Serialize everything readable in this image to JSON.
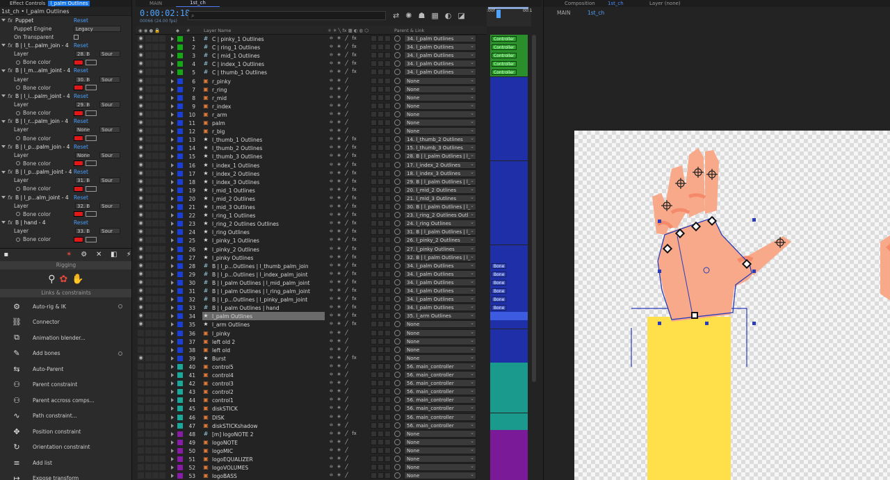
{
  "effect_controls": {
    "tab_label": "Effect Controls",
    "tab_layer": "l_palm Outlines",
    "breadcrumb": "1st_ch • l_palm Outlines",
    "puppet": {
      "label": "Puppet",
      "reset": "Reset",
      "engine_label": "Puppet Engine",
      "engine_value": "Legacy",
      "transparent_label": "On Transparent"
    },
    "bones": [
      {
        "name": "B | l_t...palm_join - 4",
        "layer_value": "28. B",
        "sound": "Sour"
      },
      {
        "name": "B | l_m...alm_joint - 4",
        "layer_value": "30. B",
        "sound": "Sour"
      },
      {
        "name": "B | l_i...palm_joint - 4",
        "layer_value": "29. B",
        "sound": "Sour"
      },
      {
        "name": "B | l_r...palm_join - 4",
        "layer_value": "None",
        "sound": "Sour"
      },
      {
        "name": "B | l_p...palm_join - 4",
        "layer_value": "None",
        "sound": "Sour"
      },
      {
        "name": "B | l_p...palm_joint - 4",
        "layer_value": "31. B",
        "sound": "Sour"
      },
      {
        "name": "B | l_p...alm_joint - 4",
        "layer_value": "32. B",
        "sound": "Sour"
      },
      {
        "name": "B | hand - 4",
        "layer_value": "33. B",
        "sound": "Sour"
      }
    ],
    "reset_label": "Reset",
    "layer_label": "Layer",
    "bone_color_label": "Bone color",
    "bone_color": "#e01818"
  },
  "rigging": {
    "title": "Rigging",
    "links_title": "Links & constraints",
    "tools": [
      {
        "icon": "⚙",
        "label": "Auto-rig & IK",
        "dot": true
      },
      {
        "icon": "⛓",
        "label": "Connector",
        "dot": false
      },
      {
        "icon": "⧉",
        "label": "Animation blender...",
        "dot": false
      },
      {
        "icon": "✎",
        "label": "Add bones",
        "dot": true
      },
      {
        "icon": "⇆",
        "label": "Auto-Parent",
        "dot": false
      },
      {
        "icon": "⚇",
        "label": "Parent constraint",
        "dot": false
      },
      {
        "icon": "⚇",
        "label": "Parent accross comps...",
        "dot": false
      },
      {
        "icon": "∿",
        "label": "Path constraint...",
        "dot": false
      },
      {
        "icon": "✥",
        "label": "Position constraint",
        "dot": false
      },
      {
        "icon": "↻",
        "label": "Orientation constraint",
        "dot": false
      },
      {
        "icon": "≡",
        "label": "Add list",
        "dot": false
      },
      {
        "icon": "↦",
        "label": "Expose transform",
        "dot": false
      }
    ]
  },
  "timeline": {
    "tabs": [
      "MAIN",
      "1st_ch"
    ],
    "timecode": "0:00:02:18",
    "fps": "00066 (24.00 fps)",
    "search_placeholder": "⌕",
    "col_layer_name": "Layer Name",
    "col_parent": "Parent & Link",
    "ruler_start": ":00f",
    "ruler_end": "00:1",
    "layers": [
      {
        "n": "1",
        "c": "#14a814",
        "t": "hash",
        "name": "C | pinky_1 Outlines",
        "p": "34. l_palm Outlines",
        "k": "Controller",
        "trk": "#2a8f2a"
      },
      {
        "n": "2",
        "c": "#14a814",
        "t": "hash",
        "name": "C | ring_1 Outlines",
        "p": "34. l_palm Outlines",
        "k": "Controller",
        "trk": "#2a8f2a"
      },
      {
        "n": "3",
        "c": "#14a814",
        "t": "hash",
        "name": "C | mid_1 Outlines",
        "p": "34. l_palm Outlines",
        "k": "Controller",
        "trk": "#2a8f2a"
      },
      {
        "n": "4",
        "c": "#14a814",
        "t": "hash",
        "name": "C | index_1 Outlines",
        "p": "34. l_palm Outlines",
        "k": "Controller",
        "trk": "#2a8f2a"
      },
      {
        "n": "5",
        "c": "#14a814",
        "t": "hash",
        "name": "C | thumb_1 Outlines",
        "p": "34. l_palm Outlines",
        "k": "Controller",
        "trk": "#2a8f2a"
      },
      {
        "n": "6",
        "c": "#1a3fd8",
        "t": "pup",
        "name": "r_pinky",
        "p": "None",
        "k": "",
        "trk": "#1f2fa8"
      },
      {
        "n": "7",
        "c": "#1a3fd8",
        "t": "pup",
        "name": "r_ring",
        "p": "None",
        "k": "",
        "trk": "#1f2fa8"
      },
      {
        "n": "8",
        "c": "#1a3fd8",
        "t": "pup",
        "name": "r_mid",
        "p": "None",
        "k": "",
        "trk": "#1f2fa8"
      },
      {
        "n": "9",
        "c": "#1a3fd8",
        "t": "pup",
        "name": "r_index",
        "p": "None",
        "k": "",
        "trk": "#1f2fa8"
      },
      {
        "n": "10",
        "c": "#1a3fd8",
        "t": "pup",
        "name": "r_arm",
        "p": "None",
        "k": "",
        "trk": "#1f2fa8"
      },
      {
        "n": "11",
        "c": "#1a3fd8",
        "t": "pup",
        "name": "palm",
        "p": "None",
        "k": "",
        "trk": "#1f2fa8"
      },
      {
        "n": "12",
        "c": "#1a3fd8",
        "t": "pup",
        "name": "r_big",
        "p": "None",
        "k": "",
        "trk": "#1f2fa8"
      },
      {
        "n": "13",
        "c": "#1a3fd8",
        "t": "shp",
        "name": "l_thumb_1 Outlines",
        "p": "14. l_thumb_2 Outlines",
        "k": "",
        "trk": "#1f2fa8"
      },
      {
        "n": "14",
        "c": "#1a3fd8",
        "t": "shp",
        "name": "l_thumb_2 Outlines",
        "p": "15. l_thumb_3 Outlines",
        "k": "",
        "trk": "#1f2fa8"
      },
      {
        "n": "15",
        "c": "#1a3fd8",
        "t": "shp",
        "name": "l_thumb_3 Outlines",
        "p": "28. B | l_palm Outlines | l_",
        "k": "",
        "trk": "#1f2fa8"
      },
      {
        "n": "16",
        "c": "#1a3fd8",
        "t": "shp",
        "name": "l_index_1 Outlines",
        "p": "17. l_index_2 Outlines",
        "k": "",
        "trk": "#1f2fa8"
      },
      {
        "n": "17",
        "c": "#1a3fd8",
        "t": "shp",
        "name": "l_index_2 Outlines",
        "p": "18. l_index_3 Outlines",
        "k": "",
        "trk": "#1f2fa8"
      },
      {
        "n": "18",
        "c": "#1a3fd8",
        "t": "shp",
        "name": "l_index_3 Outlines",
        "p": "29. B | l_palm Outlines | l_",
        "k": "",
        "trk": "#1f2fa8"
      },
      {
        "n": "19",
        "c": "#1a3fd8",
        "t": "shp",
        "name": "l_mid_1 Outlines",
        "p": "20. l_mid_2 Outlines",
        "k": "",
        "trk": "#1f2fa8"
      },
      {
        "n": "20",
        "c": "#1a3fd8",
        "t": "shp",
        "name": "l_mid_2 Outlines",
        "p": "21. l_mid_3 Outlines",
        "k": "",
        "trk": "#1f2fa8"
      },
      {
        "n": "21",
        "c": "#1a3fd8",
        "t": "shp",
        "name": "l_mid_3 Outlines",
        "p": "30. B | l_palm Outlines | l_",
        "k": "",
        "trk": "#1f2fa8"
      },
      {
        "n": "22",
        "c": "#1a3fd8",
        "t": "shp",
        "name": "l_ring_1 Outlines",
        "p": "23. l_ring_2 Outlines Outl",
        "k": "",
        "trk": "#1f2fa8"
      },
      {
        "n": "23",
        "c": "#1a3fd8",
        "t": "shp",
        "name": "l_ring_2 Outlines Outlines",
        "p": "24. l_ring Outlines",
        "k": "",
        "trk": "#1f2fa8"
      },
      {
        "n": "24",
        "c": "#1a3fd8",
        "t": "shp",
        "name": "l_ring Outlines",
        "p": "31. B | l_palm Outlines | l_",
        "k": "",
        "trk": "#1f2fa8"
      },
      {
        "n": "25",
        "c": "#1a3fd8",
        "t": "shp",
        "name": "l_pinky_1 Outlines",
        "p": "26. l_pinky_2 Outlines",
        "k": "",
        "trk": "#1f2fa8"
      },
      {
        "n": "26",
        "c": "#1a3fd8",
        "t": "shp",
        "name": "l_pinky_2 Outlines",
        "p": "27. l_pinky Outlines",
        "k": "",
        "trk": "#1f2fa8"
      },
      {
        "n": "27",
        "c": "#1a3fd8",
        "t": "shp",
        "name": "l_pinky Outlines",
        "p": "32. B | l_palm Outlines | l_",
        "k": "",
        "trk": "#1f2fa8"
      },
      {
        "n": "28",
        "c": "#1a3fd8",
        "t": "hash",
        "name": "B | l_p...Outlines | l_thumb_palm_join",
        "p": "34. l_palm Outlines",
        "k": "Bone",
        "trk": "#1f2fa8"
      },
      {
        "n": "29",
        "c": "#1a3fd8",
        "t": "hash",
        "name": "B | l_p...Outlines | l_index_palm_joint",
        "p": "34. l_palm Outlines",
        "k": "Bone",
        "trk": "#1f2fa8"
      },
      {
        "n": "30",
        "c": "#1a3fd8",
        "t": "hash",
        "name": "B | l_palm Outlines | l_mid_palm_joint",
        "p": "34. l_palm Outlines",
        "k": "Bone",
        "trk": "#1f2fa8"
      },
      {
        "n": "31",
        "c": "#1a3fd8",
        "t": "hash",
        "name": "B | l_palm Outlines | l_ring_palm_joint",
        "p": "34. l_palm Outlines",
        "k": "Bone",
        "trk": "#1f2fa8"
      },
      {
        "n": "32",
        "c": "#1a3fd8",
        "t": "hash",
        "name": "B | l_p...Outlines | l_pinky_palm_joint",
        "p": "34. l_palm Outlines",
        "k": "Bone",
        "trk": "#1f2fa8"
      },
      {
        "n": "33",
        "c": "#1a3fd8",
        "t": "hash",
        "name": "B | l_palm Outlines | hand",
        "p": "34. l_palm Outlines",
        "k": "Bone",
        "trk": "#1f2fa8"
      },
      {
        "n": "34",
        "c": "#1a3fd8",
        "t": "shp",
        "name": "l_palm Outlines",
        "p": "35. l_arm Outlines",
        "k": "",
        "trk": "#3d5be0",
        "sel": true
      },
      {
        "n": "35",
        "c": "#1a3fd8",
        "t": "shp",
        "name": "l_arm Outlines",
        "p": "None",
        "k": "",
        "trk": "#1f2fa8"
      },
      {
        "n": "36",
        "c": "#1a3fd8",
        "t": "pup",
        "name": "l_pinky",
        "p": "None",
        "k": "",
        "trk": "#1f2fa8"
      },
      {
        "n": "37",
        "c": "#1a3fd8",
        "t": "pup",
        "name": "left old 2",
        "p": "None",
        "k": "",
        "trk": "#1f2fa8"
      },
      {
        "n": "38",
        "c": "#1a3fd8",
        "t": "pup",
        "name": "left old",
        "p": "None",
        "k": "",
        "trk": "#1f2fa8"
      },
      {
        "n": "39",
        "c": "#1a3fd8",
        "t": "shp",
        "name": "Burst",
        "p": "None",
        "k": "",
        "trk": "#1f2fa8"
      },
      {
        "n": "40",
        "c": "#1aa89a",
        "t": "pup",
        "name": "control5",
        "p": "56. main_controller",
        "k": "",
        "trk": "#1a9a8c"
      },
      {
        "n": "41",
        "c": "#1aa89a",
        "t": "pup",
        "name": "control4",
        "p": "56. main_controller",
        "k": "",
        "trk": "#1a9a8c"
      },
      {
        "n": "42",
        "c": "#1aa89a",
        "t": "pup",
        "name": "control3",
        "p": "56. main_controller",
        "k": "",
        "trk": "#1a9a8c"
      },
      {
        "n": "43",
        "c": "#1aa89a",
        "t": "pup",
        "name": "control2",
        "p": "56. main_controller",
        "k": "",
        "trk": "#1a9a8c"
      },
      {
        "n": "44",
        "c": "#1aa89a",
        "t": "pup",
        "name": "control1",
        "p": "56. main_controller",
        "k": "",
        "trk": "#1a9a8c"
      },
      {
        "n": "45",
        "c": "#1aa89a",
        "t": "pup",
        "name": "diskSTICK",
        "p": "56. main_controller",
        "k": "",
        "trk": "#1a9a8c"
      },
      {
        "n": "46",
        "c": "#1aa89a",
        "t": "pup",
        "name": "DISK",
        "p": "56. main_controller",
        "k": "",
        "trk": "#1a9a8c"
      },
      {
        "n": "47",
        "c": "#1aa89a",
        "t": "pup",
        "name": "diskSTICKshadow",
        "p": "56. main_controller",
        "k": "",
        "trk": "#1a9a8c"
      },
      {
        "n": "48",
        "c": "#8a1aa8",
        "t": "hash",
        "name": "[m] logoNOTE 2",
        "p": "None",
        "k": "",
        "trk": "#7a1a98"
      },
      {
        "n": "49",
        "c": "#8a1aa8",
        "t": "pup",
        "name": "logoNOTE",
        "p": "None",
        "k": "",
        "trk": "#7a1a98"
      },
      {
        "n": "50",
        "c": "#8a1aa8",
        "t": "pup",
        "name": "logoMIC",
        "p": "None",
        "k": "",
        "trk": "#7a1a98"
      },
      {
        "n": "51",
        "c": "#8a1aa8",
        "t": "pup",
        "name": "logoEQUALIZER",
        "p": "None",
        "k": "",
        "trk": "#7a1a98"
      },
      {
        "n": "52",
        "c": "#8a1aa8",
        "t": "pup",
        "name": "logoVOLUMES",
        "p": "None",
        "k": "",
        "trk": "#7a1a98"
      },
      {
        "n": "53",
        "c": "#8a1aa8",
        "t": "pup",
        "name": "logoBASS",
        "p": "None",
        "k": "",
        "trk": "#7a1a98"
      }
    ]
  },
  "composition": {
    "tab_label": "Composition",
    "tab_comp": "1st_ch",
    "layer_tab": "Layer (none)",
    "crumb_main": "MAIN",
    "crumb_current": "1st_ch",
    "colors": {
      "skin": "#f7a98a",
      "skin_shade": "#f58a6a",
      "nail": "#f9c2aa",
      "sleeve": "#ffe04a",
      "outline": "#2a3cb8"
    }
  }
}
